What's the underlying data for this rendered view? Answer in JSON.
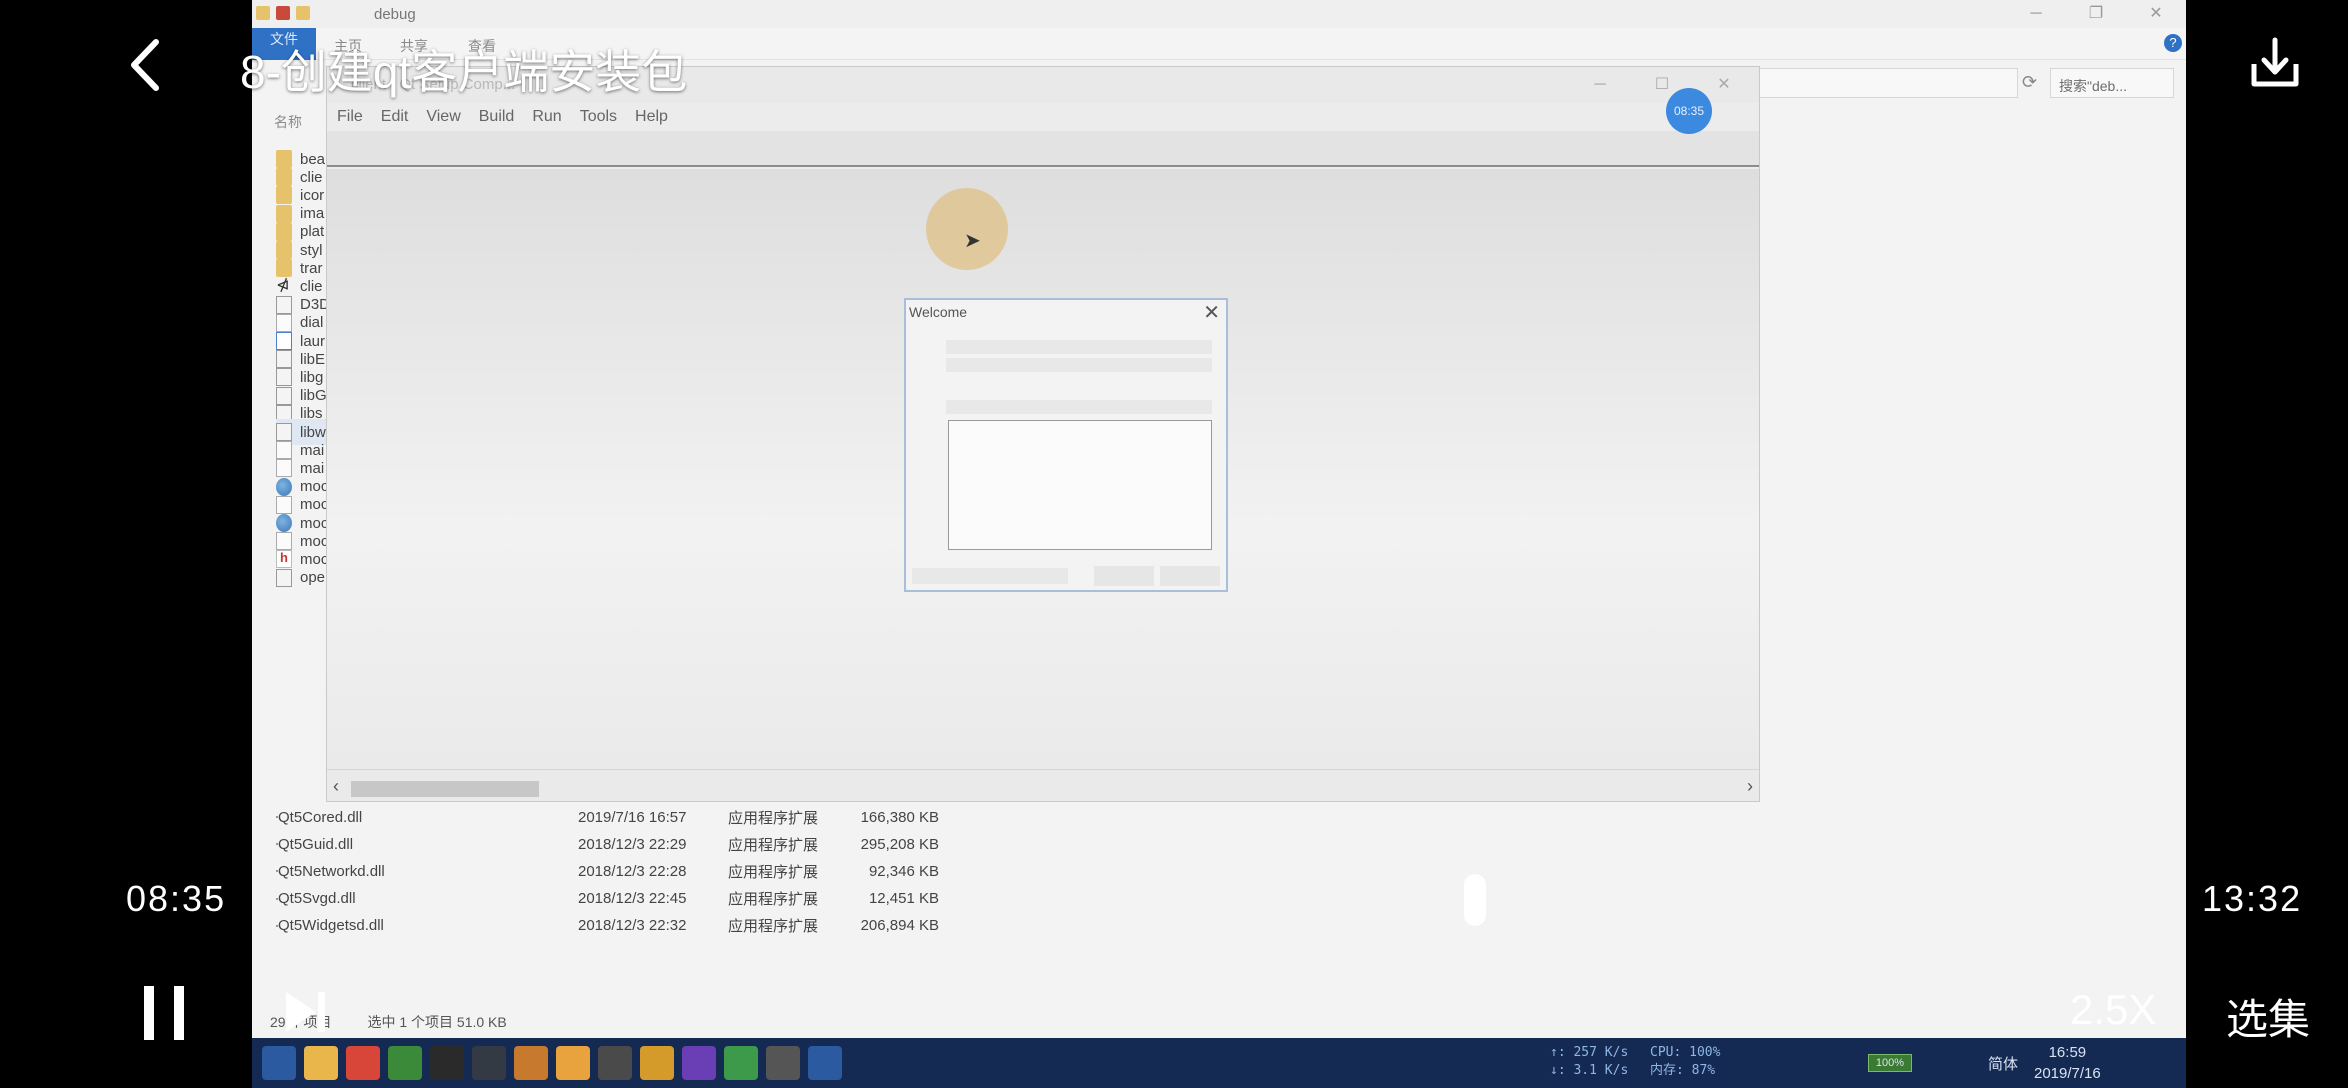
{
  "player": {
    "title": "8-创建qt客户端安装包",
    "current_time": "08:35",
    "total_time": "13:32",
    "speed": "2.5X",
    "episodes_label": "选集",
    "progress_fraction": 0.634
  },
  "explorer": {
    "title": "debug",
    "ribbon_tabs": [
      "文件",
      "主页",
      "共享",
      "查看"
    ],
    "search_placeholder": "搜索\"deb...",
    "column_header": "名称",
    "truncated_files": [
      {
        "name": "bea",
        "icon": "folder-icon"
      },
      {
        "name": "clie",
        "icon": "folder-icon"
      },
      {
        "name": "icor",
        "icon": "folder-icon"
      },
      {
        "name": "ima",
        "icon": "folder-icon"
      },
      {
        "name": "plat",
        "icon": "folder-icon"
      },
      {
        "name": "styl",
        "icon": "folder-icon"
      },
      {
        "name": "trar",
        "icon": "folder-icon"
      },
      {
        "name": "clie",
        "icon": "vs-project-icon"
      },
      {
        "name": "D3D",
        "icon": "dll-icon"
      },
      {
        "name": "dial",
        "icon": "file-icon"
      },
      {
        "name": "laur",
        "icon": "app-icon"
      },
      {
        "name": "libE",
        "icon": "dll-icon"
      },
      {
        "name": "libg",
        "icon": "dll-icon"
      },
      {
        "name": "libG",
        "icon": "dll-icon"
      },
      {
        "name": "libs",
        "icon": "dll-icon"
      },
      {
        "name": "libw",
        "icon": "dll-icon"
      },
      {
        "name": "mai",
        "icon": "file-icon"
      },
      {
        "name": "mai",
        "icon": "file-icon"
      },
      {
        "name": "moc",
        "icon": "globe-icon"
      },
      {
        "name": "moc",
        "icon": "file-icon"
      },
      {
        "name": "moc",
        "icon": "globe-icon"
      },
      {
        "name": "moc",
        "icon": "file-icon"
      },
      {
        "name": "moc",
        "icon": "header-icon"
      },
      {
        "name": "ope",
        "icon": "dll-icon"
      }
    ],
    "detail_files": [
      {
        "name": "Qt5Cored.dll",
        "date": "2019/7/16 16:57",
        "type": "应用程序扩展",
        "size": "166,380 KB"
      },
      {
        "name": "Qt5Guid.dll",
        "date": "2018/12/3 22:29",
        "type": "应用程序扩展",
        "size": "295,208 KB"
      },
      {
        "name": "Qt5Networkd.dll",
        "date": "2018/12/3 22:28",
        "type": "应用程序扩展",
        "size": "92,346 KB"
      },
      {
        "name": "Qt5Svgd.dll",
        "date": "2018/12/3 22:45",
        "type": "应用程序扩展",
        "size": "12,451 KB"
      },
      {
        "name": "Qt5Widgetsd.dll",
        "date": "2018/12/3 22:32",
        "type": "应用程序扩展",
        "size": "206,894 KB"
      }
    ],
    "status_count": "29 个项目",
    "status_selected": "选中 1 个项目 51.0 KB"
  },
  "qt_window": {
    "title": "client - Qt Setup Comp...",
    "menu": [
      "File",
      "Edit",
      "View",
      "Build",
      "Run",
      "Tools",
      "Help"
    ],
    "timer": "08:35"
  },
  "welcome_dialog": {
    "title": "Welcome",
    "close": "✕"
  },
  "taskbar": {
    "net_up": "↑: 257 K/s",
    "net_down": "↓: 3.1 K/s",
    "cpu": "CPU: 100%",
    "mem": "内存: 87%",
    "battery": "100%",
    "ime": "简体",
    "clock_time": "16:59",
    "clock_date": "2019/7/16",
    "colors": {
      "bar": "#142a52",
      "icons": [
        "#2b5aa0",
        "#e8b64a",
        "#d8463a",
        "#3a8a3a",
        "#2a2a2a",
        "#333a44",
        "#c77a2e",
        "#e9a33e",
        "#4a4a4a",
        "#d49a2a",
        "#6a3fb5",
        "#3d9a4b",
        "#555555",
        "#2b5aa0"
      ]
    }
  }
}
